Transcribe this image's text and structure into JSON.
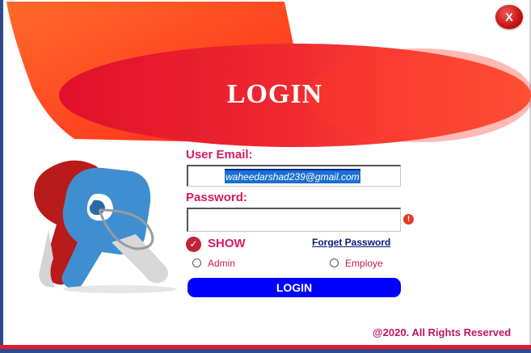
{
  "window": {
    "close_label": "X"
  },
  "banner": {
    "title": "LOGIN"
  },
  "form": {
    "email_label": "User Email:",
    "email_value": "waheedarshad239@gmail.com",
    "password_label": "Password:",
    "password_value": "",
    "show_label": "SHOW",
    "forget_label": "Forget Password",
    "roles": [
      "Admin",
      "Employe"
    ],
    "login_label": "LOGIN"
  },
  "footer": {
    "copyright": "@2020. All Rights Reserved"
  },
  "colors": {
    "accent": "#d81b60",
    "button": "#0000ff",
    "banner": "#e31b2e"
  }
}
